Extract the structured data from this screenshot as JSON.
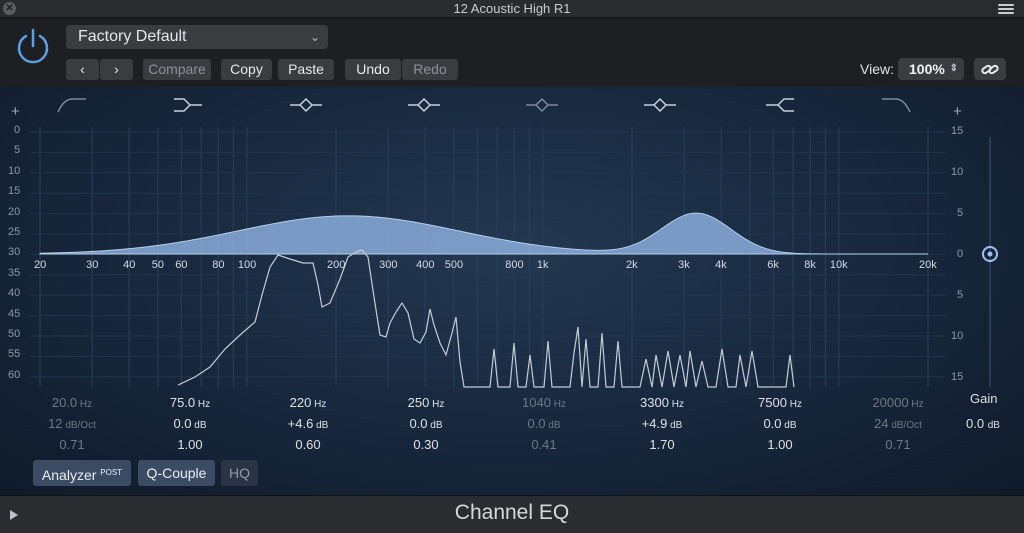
{
  "window": {
    "title": "12 Acoustic High R1"
  },
  "header": {
    "preset": "Factory Default",
    "compare": "Compare",
    "copy": "Copy",
    "paste": "Paste",
    "undo": "Undo",
    "redo": "Redo",
    "view_label": "View:",
    "view_value": "100%"
  },
  "eq": {
    "left_axis": [
      "0",
      "5",
      "10",
      "15",
      "20",
      "25",
      "30",
      "35",
      "40",
      "45",
      "50",
      "55",
      "60"
    ],
    "right_axis": [
      "15",
      "10",
      "5",
      "0",
      "5",
      "10",
      "15"
    ],
    "freq_labels": [
      "20",
      "30",
      "40",
      "50",
      "60",
      "80",
      "100",
      "200",
      "300",
      "400",
      "500",
      "800",
      "1k",
      "2k",
      "3k",
      "4k",
      "6k",
      "8k",
      "10k",
      "20k"
    ],
    "bands": [
      {
        "freq": "20.0",
        "freq_unit": "Hz",
        "gain": "12",
        "gain_unit": "dB/Oct",
        "q": "0.71",
        "enabled": false
      },
      {
        "freq": "75.0",
        "freq_unit": "Hz",
        "gain": "0.0",
        "gain_unit": "dB",
        "q": "1.00",
        "enabled": true
      },
      {
        "freq": "220",
        "freq_unit": "Hz",
        "gain": "+4.6",
        "gain_unit": "dB",
        "q": "0.60",
        "enabled": true
      },
      {
        "freq": "250",
        "freq_unit": "Hz",
        "gain": "0.0",
        "gain_unit": "dB",
        "q": "0.30",
        "enabled": true
      },
      {
        "freq": "1040",
        "freq_unit": "Hz",
        "gain": "0.0",
        "gain_unit": "dB",
        "q": "0.41",
        "enabled": false
      },
      {
        "freq": "3300",
        "freq_unit": "Hz",
        "gain": "+4.9",
        "gain_unit": "dB",
        "q": "1.70",
        "enabled": true
      },
      {
        "freq": "7500",
        "freq_unit": "Hz",
        "gain": "0.0",
        "gain_unit": "dB",
        "q": "1.00",
        "enabled": true
      },
      {
        "freq": "20000",
        "freq_unit": "Hz",
        "gain": "24",
        "gain_unit": "dB/Oct",
        "q": "0.71",
        "enabled": false
      }
    ],
    "gain_label": "Gain",
    "gain_value": "0.0",
    "gain_unit": "dB"
  },
  "footer_buttons": {
    "analyzer": "Analyzer",
    "analyzer_mode": "POST",
    "q_couple": "Q-Couple",
    "hq": "HQ"
  },
  "plugin_name": "Channel EQ",
  "colors": {
    "accent": "#7fa4d6",
    "curve_fill": "#8aaddb",
    "background": "#1a2b42"
  }
}
